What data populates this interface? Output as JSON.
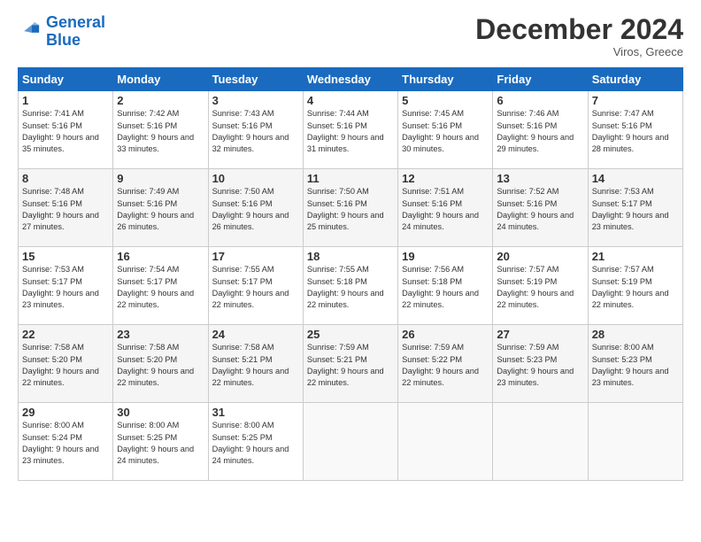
{
  "header": {
    "logo_general": "General",
    "logo_blue": "Blue",
    "month_title": "December 2024",
    "location": "Viros, Greece"
  },
  "weekdays": [
    "Sunday",
    "Monday",
    "Tuesday",
    "Wednesday",
    "Thursday",
    "Friday",
    "Saturday"
  ],
  "weeks": [
    [
      {
        "day": "1",
        "info": "Sunrise: 7:41 AM\nSunset: 5:16 PM\nDaylight: 9 hours and 35 minutes."
      },
      {
        "day": "2",
        "info": "Sunrise: 7:42 AM\nSunset: 5:16 PM\nDaylight: 9 hours and 33 minutes."
      },
      {
        "day": "3",
        "info": "Sunrise: 7:43 AM\nSunset: 5:16 PM\nDaylight: 9 hours and 32 minutes."
      },
      {
        "day": "4",
        "info": "Sunrise: 7:44 AM\nSunset: 5:16 PM\nDaylight: 9 hours and 31 minutes."
      },
      {
        "day": "5",
        "info": "Sunrise: 7:45 AM\nSunset: 5:16 PM\nDaylight: 9 hours and 30 minutes."
      },
      {
        "day": "6",
        "info": "Sunrise: 7:46 AM\nSunset: 5:16 PM\nDaylight: 9 hours and 29 minutes."
      },
      {
        "day": "7",
        "info": "Sunrise: 7:47 AM\nSunset: 5:16 PM\nDaylight: 9 hours and 28 minutes."
      }
    ],
    [
      {
        "day": "8",
        "info": "Sunrise: 7:48 AM\nSunset: 5:16 PM\nDaylight: 9 hours and 27 minutes."
      },
      {
        "day": "9",
        "info": "Sunrise: 7:49 AM\nSunset: 5:16 PM\nDaylight: 9 hours and 26 minutes."
      },
      {
        "day": "10",
        "info": "Sunrise: 7:50 AM\nSunset: 5:16 PM\nDaylight: 9 hours and 26 minutes."
      },
      {
        "day": "11",
        "info": "Sunrise: 7:50 AM\nSunset: 5:16 PM\nDaylight: 9 hours and 25 minutes."
      },
      {
        "day": "12",
        "info": "Sunrise: 7:51 AM\nSunset: 5:16 PM\nDaylight: 9 hours and 24 minutes."
      },
      {
        "day": "13",
        "info": "Sunrise: 7:52 AM\nSunset: 5:16 PM\nDaylight: 9 hours and 24 minutes."
      },
      {
        "day": "14",
        "info": "Sunrise: 7:53 AM\nSunset: 5:17 PM\nDaylight: 9 hours and 23 minutes."
      }
    ],
    [
      {
        "day": "15",
        "info": "Sunrise: 7:53 AM\nSunset: 5:17 PM\nDaylight: 9 hours and 23 minutes."
      },
      {
        "day": "16",
        "info": "Sunrise: 7:54 AM\nSunset: 5:17 PM\nDaylight: 9 hours and 22 minutes."
      },
      {
        "day": "17",
        "info": "Sunrise: 7:55 AM\nSunset: 5:17 PM\nDaylight: 9 hours and 22 minutes."
      },
      {
        "day": "18",
        "info": "Sunrise: 7:55 AM\nSunset: 5:18 PM\nDaylight: 9 hours and 22 minutes."
      },
      {
        "day": "19",
        "info": "Sunrise: 7:56 AM\nSunset: 5:18 PM\nDaylight: 9 hours and 22 minutes."
      },
      {
        "day": "20",
        "info": "Sunrise: 7:57 AM\nSunset: 5:19 PM\nDaylight: 9 hours and 22 minutes."
      },
      {
        "day": "21",
        "info": "Sunrise: 7:57 AM\nSunset: 5:19 PM\nDaylight: 9 hours and 22 minutes."
      }
    ],
    [
      {
        "day": "22",
        "info": "Sunrise: 7:58 AM\nSunset: 5:20 PM\nDaylight: 9 hours and 22 minutes."
      },
      {
        "day": "23",
        "info": "Sunrise: 7:58 AM\nSunset: 5:20 PM\nDaylight: 9 hours and 22 minutes."
      },
      {
        "day": "24",
        "info": "Sunrise: 7:58 AM\nSunset: 5:21 PM\nDaylight: 9 hours and 22 minutes."
      },
      {
        "day": "25",
        "info": "Sunrise: 7:59 AM\nSunset: 5:21 PM\nDaylight: 9 hours and 22 minutes."
      },
      {
        "day": "26",
        "info": "Sunrise: 7:59 AM\nSunset: 5:22 PM\nDaylight: 9 hours and 22 minutes."
      },
      {
        "day": "27",
        "info": "Sunrise: 7:59 AM\nSunset: 5:23 PM\nDaylight: 9 hours and 23 minutes."
      },
      {
        "day": "28",
        "info": "Sunrise: 8:00 AM\nSunset: 5:23 PM\nDaylight: 9 hours and 23 minutes."
      }
    ],
    [
      {
        "day": "29",
        "info": "Sunrise: 8:00 AM\nSunset: 5:24 PM\nDaylight: 9 hours and 23 minutes."
      },
      {
        "day": "30",
        "info": "Sunrise: 8:00 AM\nSunset: 5:25 PM\nDaylight: 9 hours and 24 minutes."
      },
      {
        "day": "31",
        "info": "Sunrise: 8:00 AM\nSunset: 5:25 PM\nDaylight: 9 hours and 24 minutes."
      },
      null,
      null,
      null,
      null
    ]
  ]
}
